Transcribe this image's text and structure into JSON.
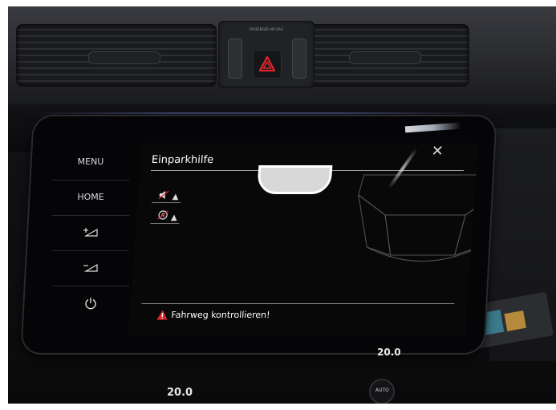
{
  "center_panel": {
    "airbag_text": "PASSENGER AIR BAG"
  },
  "infotainment": {
    "left_buttons": {
      "menu": "MENU",
      "home": "HOME",
      "vol_up_icon": "volume-up-icon",
      "vol_down_icon": "volume-down-icon",
      "power_icon": "power-icon"
    },
    "screen": {
      "title": "Einparkhilfe",
      "close_icon": "close-icon",
      "sound_icon_label": "▲",
      "parking_icon_label": "▲",
      "status_message": "Fahrweg kontrollieren!",
      "warning_icon": "warning-triangle-icon"
    }
  },
  "climate": {
    "left_temp": "20.0",
    "right_temp": "20.0",
    "auto_label": "AUTO"
  },
  "colors": {
    "warning_red": "#e0252c",
    "hazard_red": "#e0252c",
    "screen_bg": "#080809",
    "text_white": "#ffffff"
  }
}
